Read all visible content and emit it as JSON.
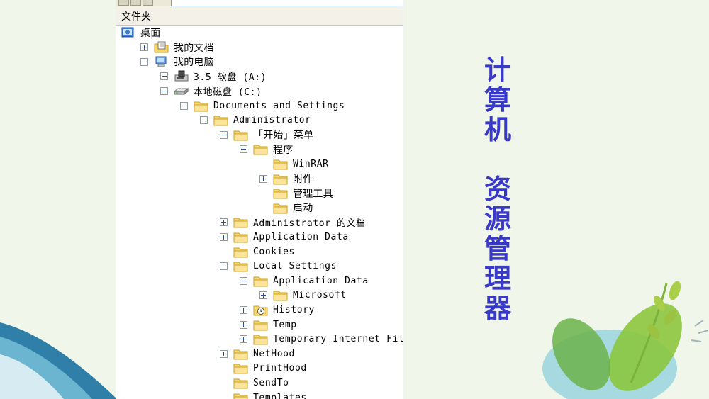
{
  "panel": {
    "header": "文件夹",
    "tree": [
      {
        "label": "桌面",
        "icon": "desktop-icon",
        "level": 0,
        "expander": "none",
        "mono": false
      },
      {
        "label": "我的文档",
        "icon": "my-documents-icon",
        "level": 1,
        "expander": "plus",
        "mono": false
      },
      {
        "label": "我的电脑",
        "icon": "my-computer-icon",
        "level": 1,
        "expander": "minus",
        "mono": false
      },
      {
        "label": "3.5 软盘 (A:)",
        "icon": "floppy-drive-icon",
        "level": 2,
        "expander": "plus",
        "mono": true
      },
      {
        "label": "本地磁盘 (C:)",
        "icon": "hard-drive-icon",
        "level": 2,
        "expander": "minus",
        "mono": true
      },
      {
        "label": "Documents and Settings",
        "icon": "folder-icon",
        "level": 3,
        "expander": "minus",
        "mono": true
      },
      {
        "label": "Administrator",
        "icon": "folder-icon",
        "level": 4,
        "expander": "minus",
        "mono": true
      },
      {
        "label": "「开始」菜单",
        "icon": "folder-icon",
        "level": 5,
        "expander": "minus",
        "mono": false
      },
      {
        "label": "程序",
        "icon": "folder-icon",
        "level": 6,
        "expander": "minus",
        "mono": false
      },
      {
        "label": "WinRAR",
        "icon": "folder-icon",
        "level": 7,
        "expander": "none",
        "mono": true
      },
      {
        "label": "附件",
        "icon": "folder-icon",
        "level": 7,
        "expander": "plus",
        "mono": false
      },
      {
        "label": "管理工具",
        "icon": "folder-icon",
        "level": 7,
        "expander": "none",
        "mono": false
      },
      {
        "label": "启动",
        "icon": "folder-icon",
        "level": 7,
        "expander": "none",
        "mono": false
      },
      {
        "label": "Administrator 的文档",
        "icon": "folder-icon",
        "level": 5,
        "expander": "plus",
        "mono": true
      },
      {
        "label": "Application Data",
        "icon": "folder-icon",
        "level": 5,
        "expander": "plus",
        "mono": true
      },
      {
        "label": "Cookies",
        "icon": "folder-icon",
        "level": 5,
        "expander": "none",
        "mono": true
      },
      {
        "label": "Local Settings",
        "icon": "folder-icon",
        "level": 5,
        "expander": "minus",
        "mono": true
      },
      {
        "label": "Application Data",
        "icon": "folder-icon",
        "level": 6,
        "expander": "minus",
        "mono": true
      },
      {
        "label": "Microsoft",
        "icon": "folder-icon",
        "level": 7,
        "expander": "plus",
        "mono": true
      },
      {
        "label": "History",
        "icon": "history-folder-icon",
        "level": 6,
        "expander": "plus",
        "mono": true
      },
      {
        "label": "Temp",
        "icon": "folder-icon",
        "level": 6,
        "expander": "plus",
        "mono": true
      },
      {
        "label": "Temporary Internet Files",
        "icon": "folder-icon",
        "level": 6,
        "expander": "plus",
        "mono": true
      },
      {
        "label": "NetHood",
        "icon": "folder-icon",
        "level": 5,
        "expander": "plus",
        "mono": true
      },
      {
        "label": "PrintHood",
        "icon": "folder-icon",
        "level": 5,
        "expander": "none",
        "mono": true
      },
      {
        "label": "SendTo",
        "icon": "folder-icon",
        "level": 5,
        "expander": "none",
        "mono": true
      },
      {
        "label": "Templates",
        "icon": "folder-icon",
        "level": 5,
        "expander": "none",
        "mono": true
      }
    ]
  },
  "slide": {
    "title_part1": "计算机",
    "title_part2": "资源管理器",
    "title_color": "#3939c9"
  },
  "colors": {
    "folder": "#f6d66e",
    "folder_edge": "#c9a227",
    "background": "#f1f6ea"
  }
}
